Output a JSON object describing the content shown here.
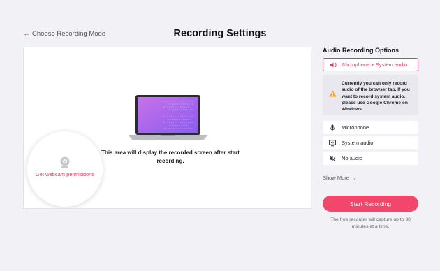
{
  "header": {
    "back_label": "Choose Recording Mode",
    "title": "Recording Settings"
  },
  "preview": {
    "placeholder_text": "This area will display the recorded screen after start recording.",
    "webcam_link": "Get webcam permissions",
    "icons": [
      "laptop-icon",
      "webcam-icon"
    ]
  },
  "audio_panel": {
    "title": "Audio Recording Options",
    "selected": {
      "label": "Microphone + System audio",
      "icon": "speaker-icon"
    },
    "warning": {
      "icon": "warning-icon",
      "text": "Currently you can only record audio of the browser tab. If you want to record system audio, please use Google Chrome on Windows."
    },
    "options": [
      {
        "label": "Microphone",
        "icon": "microphone-icon"
      },
      {
        "label": "System audio",
        "icon": "monitor-speaker-icon"
      },
      {
        "label": "No audio",
        "icon": "mute-icon"
      }
    ],
    "show_more": "Show More",
    "start_button": "Start Recording",
    "footnote": "The free recorder will capture up to 30 minutes at a time."
  },
  "colors": {
    "accent": "#e8385f",
    "button": "#f0476a",
    "background": "#f2f2f6",
    "warning_bg": "#e8e8ee",
    "warning_icon": "#f5a623"
  }
}
